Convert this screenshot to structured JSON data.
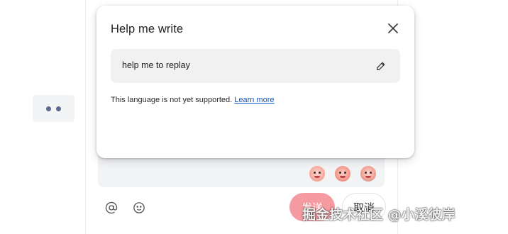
{
  "dialog": {
    "title": "Help me write",
    "prompt": "help me to replay",
    "notice": "This language is not yet supported.",
    "learn_more": "Learn more",
    "icons": {
      "close": "close-icon",
      "edit": "pencil-icon"
    }
  },
  "composer": {
    "send_label": "发送",
    "cancel_label": "取消",
    "tools": [
      "at-icon",
      "emoji-icon"
    ],
    "emojis": [
      "blush-emoji",
      "crying-emoji",
      "sunglasses-emoji"
    ]
  },
  "watermark": "掘金技术社区 @小溪彼岸",
  "colors": {
    "send": "#f59aa0",
    "link": "#0b57d0",
    "prompt_bg": "#f1f1f1",
    "comment_bg": "#f2f3f5"
  }
}
